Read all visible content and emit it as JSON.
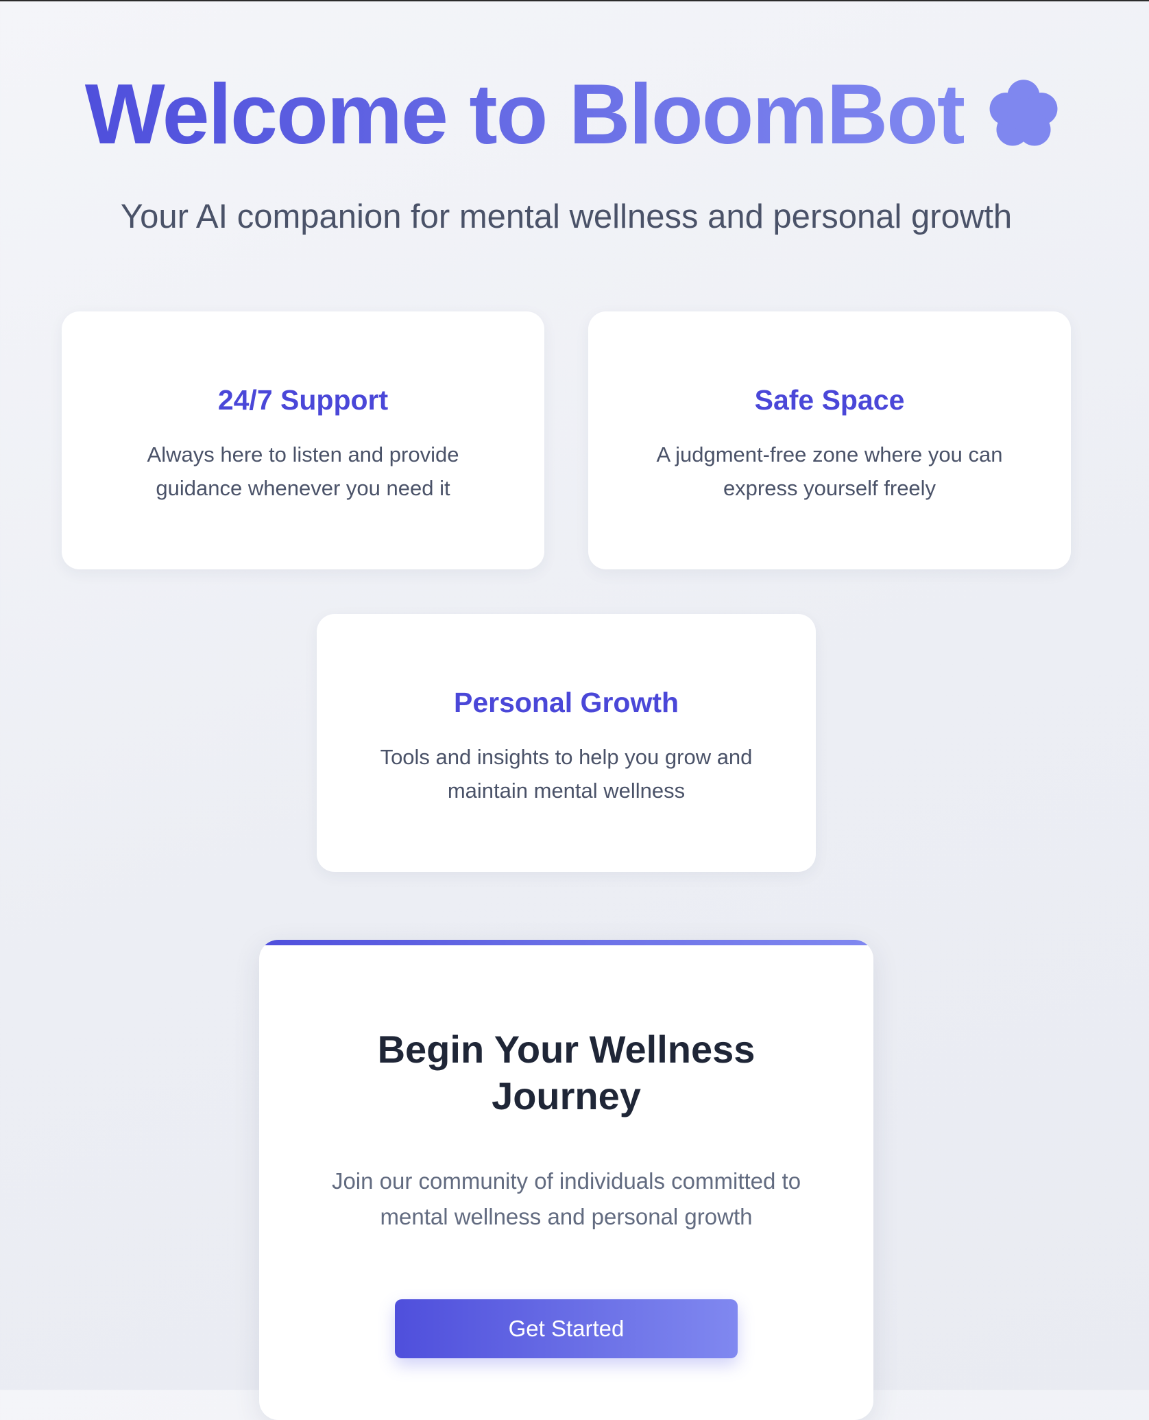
{
  "hero": {
    "title": "Welcome to BloomBot",
    "icon": "flower-icon",
    "subtitle": "Your AI companion for mental wellness and personal growth"
  },
  "features": [
    {
      "title": "24/7 Support",
      "description_lines": [
        "Always here to listen and provide",
        "guidance whenever you need it"
      ]
    },
    {
      "title": "Safe Space",
      "description_lines": [
        "A judgment-free zone where you can",
        "express yourself freely"
      ]
    },
    {
      "title": "Personal Growth",
      "description_lines": [
        "Tools and insights to help you grow and",
        "maintain mental wellness"
      ]
    }
  ],
  "cta": {
    "title_lines": [
      "Begin Your Wellness",
      "Journey"
    ],
    "description_lines": [
      "Join our community of individuals committed to",
      "mental wellness and personal growth"
    ],
    "button_label": "Get Started"
  },
  "colors": {
    "accent": "#4a47d8",
    "gradient_start": "#4f4fdc",
    "gradient_end": "#8088f0",
    "heading_dark": "#1f2637",
    "body_text": "#4a5268"
  }
}
